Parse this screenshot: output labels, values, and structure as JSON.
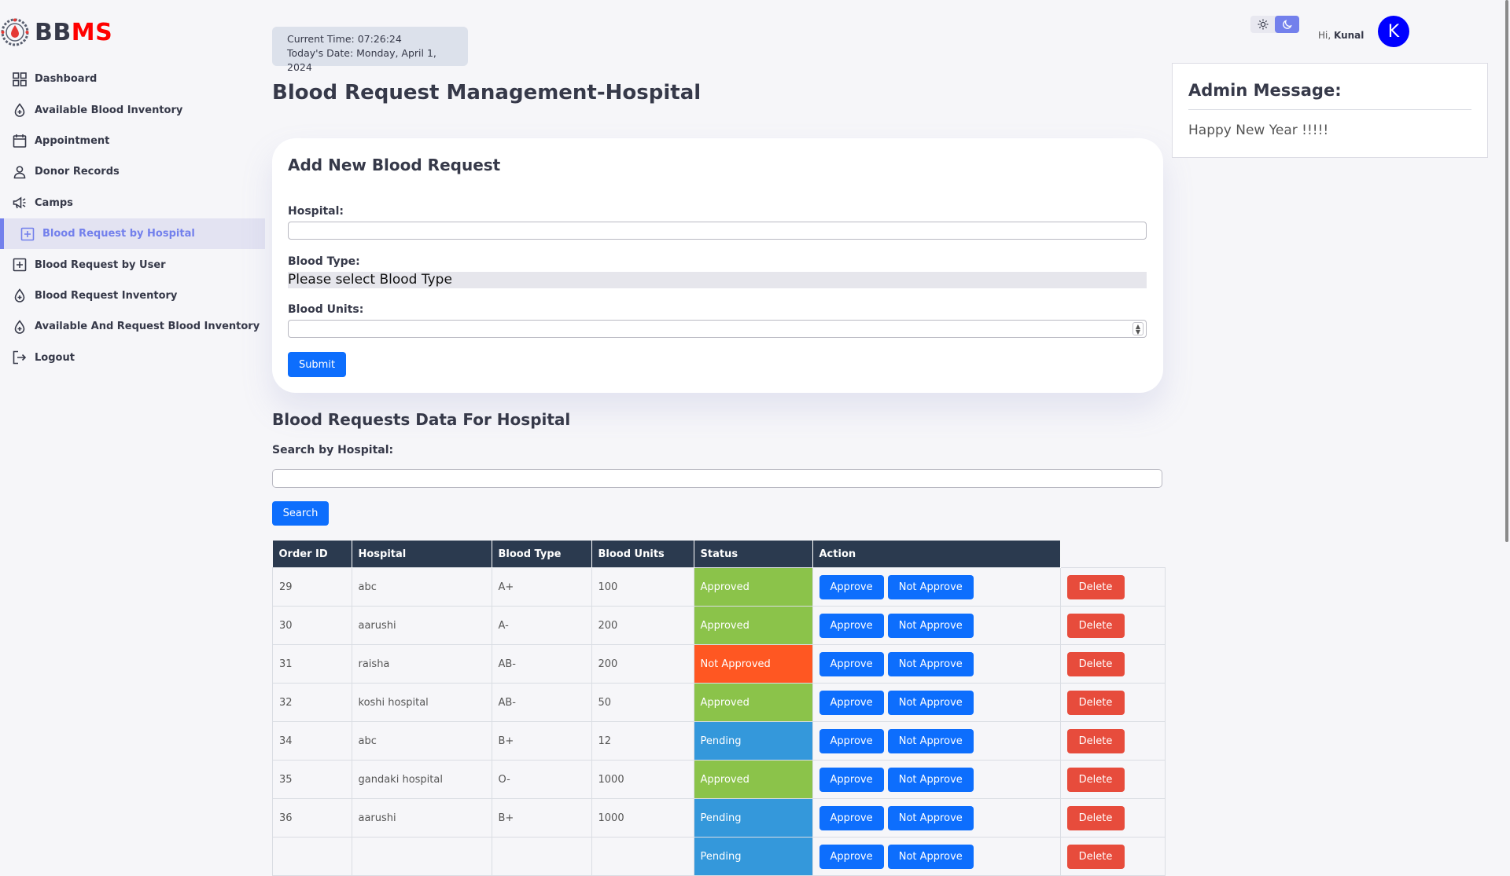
{
  "brand": {
    "part1": "BB",
    "part2": "MS"
  },
  "sidebar": {
    "items": [
      {
        "label": "Dashboard",
        "icon": "grid-icon"
      },
      {
        "label": "Available Blood Inventory",
        "icon": "blood-drop-icon"
      },
      {
        "label": "Appointment",
        "icon": "calendar-icon"
      },
      {
        "label": "Donor Records",
        "icon": "person-icon"
      },
      {
        "label": "Camps",
        "icon": "megaphone-icon"
      },
      {
        "label": "Blood Request by Hospital",
        "icon": "plus-box-icon",
        "active": true
      },
      {
        "label": "Blood Request by User",
        "icon": "plus-box-icon"
      },
      {
        "label": "Blood Request Inventory",
        "icon": "blood-drop-icon"
      },
      {
        "label": "Available And Request Blood Inventory",
        "icon": "blood-drop-icon"
      },
      {
        "label": "Logout",
        "icon": "logout-icon"
      }
    ]
  },
  "clock": {
    "time_text": "Current Time: 07:26:24",
    "date_text": "Today's Date: Monday, April 1, 2024"
  },
  "page": {
    "title": "Blood Request Management-Hospital"
  },
  "form": {
    "title": "Add New Blood Request",
    "hospital_label": "Hospital:",
    "hospital_value": "",
    "blood_type_label": "Blood Type:",
    "blood_type_selected": "Please select Blood Type",
    "blood_units_label": "Blood Units:",
    "blood_units_value": "",
    "submit_label": "Submit"
  },
  "data_section": {
    "title": "Blood Requests Data For Hospital",
    "search_label": "Search by Hospital:",
    "search_value": "",
    "search_button": "Search"
  },
  "table": {
    "headers": [
      "Order ID",
      "Hospital",
      "Blood Type",
      "Blood Units",
      "Status",
      "Action"
    ],
    "approve_label": "Approve",
    "not_approve_label": "Not Approve",
    "delete_label": "Delete",
    "rows": [
      {
        "id": "29",
        "hospital": "abc",
        "type": "A+",
        "units": "100",
        "status": "Approved"
      },
      {
        "id": "30",
        "hospital": "aarushi",
        "type": "A-",
        "units": "200",
        "status": "Approved"
      },
      {
        "id": "31",
        "hospital": "raisha",
        "type": "AB-",
        "units": "200",
        "status": "Not Approved"
      },
      {
        "id": "32",
        "hospital": "koshi hospital",
        "type": "AB-",
        "units": "50",
        "status": "Approved"
      },
      {
        "id": "34",
        "hospital": "abc",
        "type": "B+",
        "units": "12",
        "status": "Pending"
      },
      {
        "id": "35",
        "hospital": "gandaki hospital",
        "type": "O-",
        "units": "1000",
        "status": "Approved"
      },
      {
        "id": "36",
        "hospital": "aarushi",
        "type": "B+",
        "units": "1000",
        "status": "Pending"
      },
      {
        "id": "",
        "hospital": "",
        "type": "",
        "units": "",
        "status": "Pending"
      }
    ]
  },
  "header": {
    "greeting_prefix": "Hi,",
    "user_name": "Kunal",
    "avatar_letter": "K",
    "theme_mode": "dark"
  },
  "admin": {
    "title": "Admin Message:",
    "message": "Happy New Year !!!!!"
  },
  "colors": {
    "accent": "#7380ec",
    "primary_button": "#0d6efd",
    "danger": "#e74c3c",
    "approved": "#8bc34a",
    "not_approved": "#ff5722",
    "pending": "#3498db",
    "table_header": "#2b3a4f",
    "avatar": "#0000ff"
  }
}
